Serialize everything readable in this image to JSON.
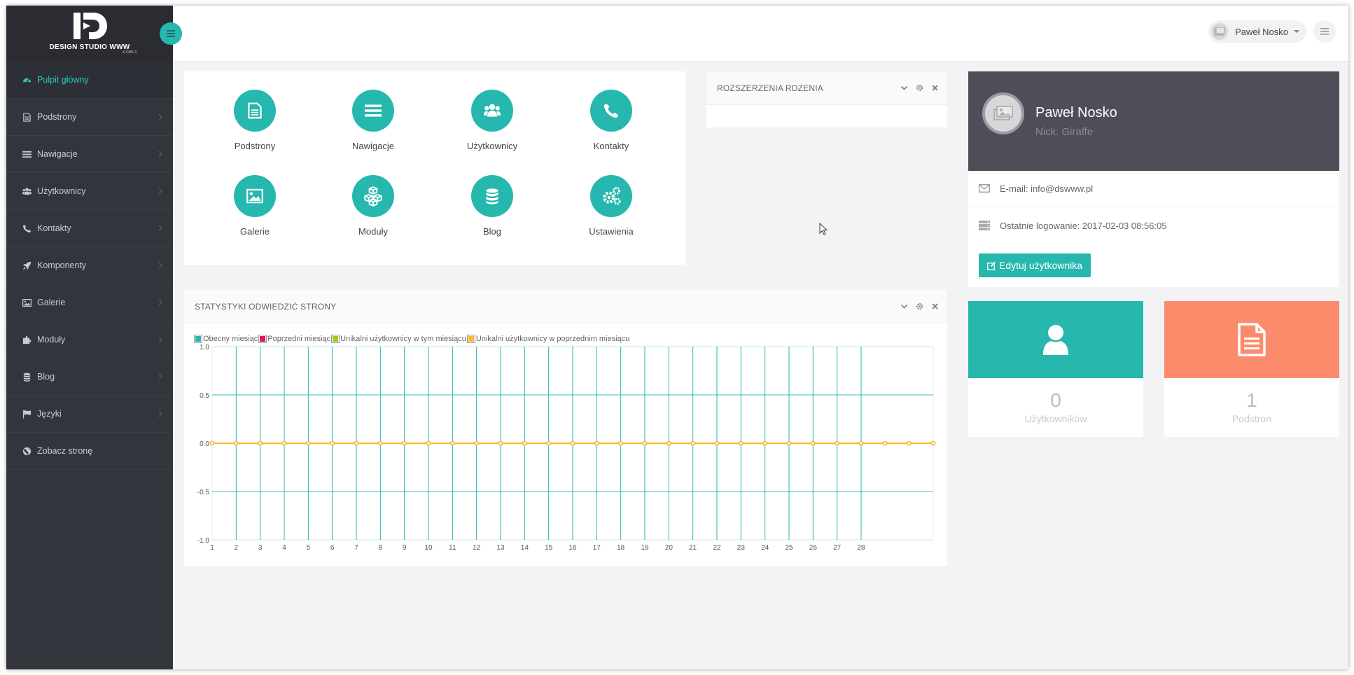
{
  "brand": {
    "name": "DESIGN STUDIO WWW",
    "sub": "X-CMS 3"
  },
  "sidebar": {
    "items": [
      {
        "label": "Pulpit główny",
        "icon": "dashboard-icon",
        "active": true
      },
      {
        "label": "Podstrony",
        "icon": "file-icon"
      },
      {
        "label": "Nawigacje",
        "icon": "list-icon"
      },
      {
        "label": "Użytkownicy",
        "icon": "users-icon"
      },
      {
        "label": "Kontakty",
        "icon": "phone-icon"
      },
      {
        "label": "Komponenty",
        "icon": "rocket-icon"
      },
      {
        "label": "Galerie",
        "icon": "image-icon"
      },
      {
        "label": "Moduły",
        "icon": "puzzle-icon"
      },
      {
        "label": "Blog",
        "icon": "database-icon"
      },
      {
        "label": "Języki",
        "icon": "flag-icon"
      },
      {
        "label": "Zobacz stronę",
        "icon": "globe-icon"
      }
    ]
  },
  "header": {
    "user_name": "Paweł Nosko"
  },
  "quick": {
    "items": [
      {
        "label": "Podstrony",
        "icon": "file-icon"
      },
      {
        "label": "Nawigacje",
        "icon": "list-icon"
      },
      {
        "label": "Użytkownicy",
        "icon": "users-icon"
      },
      {
        "label": "Kontakty",
        "icon": "phone-icon"
      },
      {
        "label": "Galerie",
        "icon": "image-icon"
      },
      {
        "label": "Moduły",
        "icon": "cubes-icon"
      },
      {
        "label": "Blog",
        "icon": "database-icon"
      },
      {
        "label": "Ustawienia",
        "icon": "gears-icon"
      }
    ]
  },
  "extensions": {
    "title": "ROZSZERZENIA RDZENIA"
  },
  "stats": {
    "title": "STATYSTYKI ODWIEDZIĆ STRONY"
  },
  "profile": {
    "name": "Paweł Nosko",
    "nick": "Nick: Giraffe",
    "email": "E-mail: info@dswww.pl",
    "last_login": "Ostatnie logowanie: 2017-02-03 08:56:05",
    "edit_label": "Edytuj użytkownika"
  },
  "counters": [
    {
      "value": "0",
      "label": "Użytkowników",
      "color": "#26b7ae",
      "icon": "user-icon"
    },
    {
      "value": "1",
      "label": "Podstron",
      "color": "#fb8b6b",
      "icon": "document-icon"
    }
  ],
  "colors": {
    "accent": "#26b7ae",
    "sidebar": "#33353d",
    "profile_header": "#4d4e58",
    "orange": "#fb8b6b"
  },
  "chart_data": {
    "type": "line",
    "x": [
      1,
      2,
      3,
      4,
      5,
      6,
      7,
      8,
      9,
      10,
      11,
      12,
      13,
      14,
      15,
      16,
      17,
      18,
      19,
      20,
      21,
      22,
      23,
      24,
      25,
      26,
      27,
      28,
      29,
      30,
      31
    ],
    "xticks": [
      1,
      2,
      3,
      4,
      5,
      6,
      7,
      8,
      9,
      10,
      11,
      12,
      13,
      14,
      15,
      16,
      17,
      18,
      19,
      20,
      21,
      22,
      23,
      24,
      25,
      26,
      27,
      28
    ],
    "ylim": [
      -1.0,
      1.0
    ],
    "yticks": [
      "1.0",
      "0.5",
      "0.0",
      "-0.5",
      "-1.0"
    ],
    "grid": true,
    "legend_position": "top-left",
    "series": [
      {
        "name": "Obecny miesiąc",
        "color": "#26b7ae",
        "values": [
          0,
          0,
          0,
          0,
          0,
          0,
          0,
          0,
          0,
          0,
          0,
          0,
          0,
          0,
          0,
          0,
          0,
          0,
          0,
          0,
          0,
          0,
          0,
          0,
          0,
          0,
          0,
          0
        ]
      },
      {
        "name": "Poprzedni miesiąc",
        "color": "#e0195a",
        "values": [
          0,
          0,
          0,
          0,
          0,
          0,
          0,
          0,
          0,
          0,
          0,
          0,
          0,
          0,
          0,
          0,
          0,
          0,
          0,
          0,
          0,
          0,
          0,
          0,
          0,
          0,
          0,
          0,
          0,
          0,
          0
        ]
      },
      {
        "name": "Unikalni użytkownicy w tym miesiącu",
        "color": "#a6c51f",
        "values": [
          0,
          0,
          0,
          0,
          0,
          0,
          0,
          0,
          0,
          0,
          0,
          0,
          0,
          0,
          0,
          0,
          0,
          0,
          0,
          0,
          0,
          0,
          0,
          0,
          0,
          0,
          0,
          0
        ]
      },
      {
        "name": "Unikalni użytkownicy w poprzednim miesiącu",
        "color": "#f5b82e",
        "values": [
          0,
          0,
          0,
          0,
          0,
          0,
          0,
          0,
          0,
          0,
          0,
          0,
          0,
          0,
          0,
          0,
          0,
          0,
          0,
          0,
          0,
          0,
          0,
          0,
          0,
          0,
          0,
          0,
          0,
          0,
          0
        ]
      }
    ]
  }
}
